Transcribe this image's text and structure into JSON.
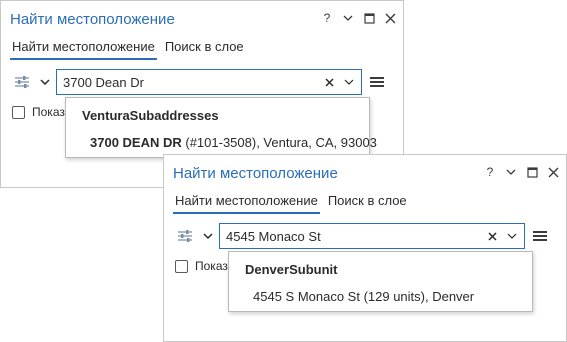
{
  "icons": {
    "help": "question-mark",
    "collapse": "chevron-down",
    "maximize": "maximize-square",
    "close": "close-x",
    "options": "sliders",
    "options_dropdown": "chevron-down",
    "clear": "clear-x",
    "suggestions": "chevron-down",
    "menu": "hamburger"
  },
  "colors": {
    "accent": "#2a6fb6",
    "text": "#2b2b2b",
    "icon": "#3c3c3c"
  },
  "panes": {
    "back": {
      "title": "Найти местоположение",
      "help_label": "?",
      "tabs": {
        "find": "Найти местоположение",
        "search_layer": "Поиск в слое"
      },
      "search_value": "3700 Dean Dr",
      "checkbox_label": "Показ",
      "dropdown": {
        "header": "VenturaSubaddresses",
        "item_bold": "3700 DEAN DR",
        "item_rest": " (#101-3508), Ventura, CA, 93003"
      }
    },
    "front": {
      "title": "Найти местоположение",
      "help_label": "?",
      "tabs": {
        "find": "Найти местоположение",
        "search_layer": "Поиск в слое"
      },
      "search_value": "4545 Monaco St",
      "checkbox_label": "Показ",
      "dropdown": {
        "header": "DenverSubunit",
        "item": "4545 S Monaco St (129 units), Denver"
      }
    }
  }
}
